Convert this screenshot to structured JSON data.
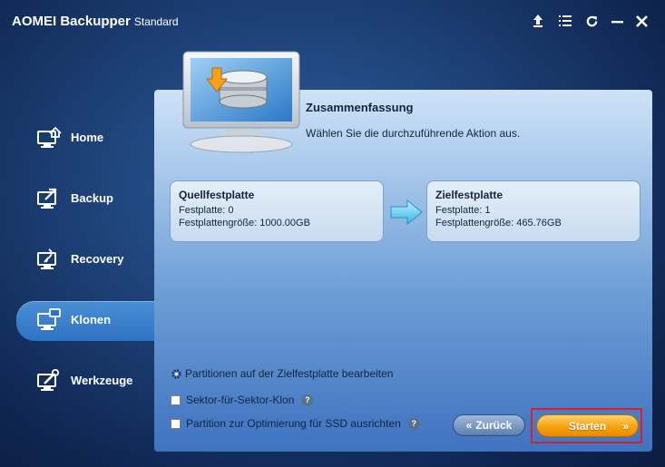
{
  "window": {
    "title": "AOMEI Backupper",
    "edition": "Standard",
    "controls": [
      "upgrade-icon",
      "menu-icon",
      "refresh-icon",
      "minimize-icon",
      "close-icon"
    ]
  },
  "sidebar": {
    "items": [
      {
        "label": "Home",
        "icon": "home-icon",
        "active": false
      },
      {
        "label": "Backup",
        "icon": "backup-icon",
        "active": false
      },
      {
        "label": "Recovery",
        "icon": "recovery-icon",
        "active": false
      },
      {
        "label": "Klonen",
        "icon": "clone-icon",
        "active": true
      },
      {
        "label": "Werkzeuge",
        "icon": "tools-icon",
        "active": false
      }
    ]
  },
  "main": {
    "title": "Zusammenfassung",
    "subtitle": "Wählen Sie die durchzuführende Aktion aus.",
    "source": {
      "heading": "Quellfestplatte",
      "disk": "Festplatte: 0",
      "size": "Festplattengröße: 1000.00GB"
    },
    "destination": {
      "heading": "Zielfestplatte",
      "disk": "Festplatte: 1",
      "size": "Festplattengröße: 465.76GB"
    },
    "options": {
      "edit_partitions": "Partitionen auf der Zielfestplatte bearbeiten",
      "sector_by_sector": "Sektor-für-Sektor-Klon",
      "ssd_align": "Partition zur Optimierung für SSD ausrichten",
      "help_glyph": "?"
    },
    "buttons": {
      "back": "Zurück",
      "back_chevron": "«",
      "start": "Starten",
      "start_chevron": "»"
    }
  },
  "colors": {
    "accent_start": "#f5a20c",
    "highlight": "#d8202a",
    "active_nav": "#3b7fcd"
  }
}
